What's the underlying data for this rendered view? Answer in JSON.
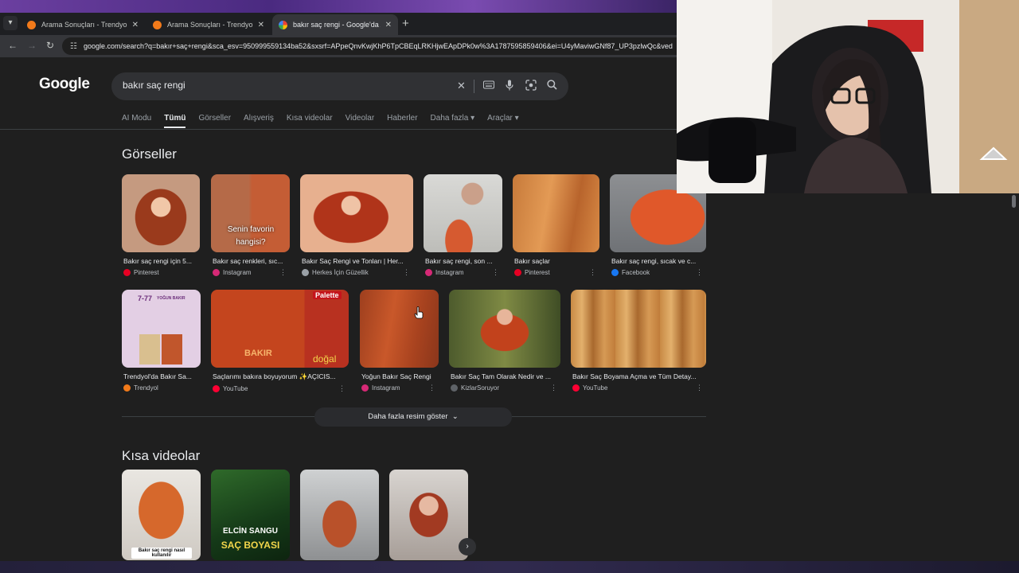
{
  "browser": {
    "tabs": [
      {
        "title": "Arama Sonuçları - Trendyol",
        "active": false
      },
      {
        "title": "Arama Sonuçları - Trendyol",
        "active": false
      },
      {
        "title": "bakır saç rengi - Google'da Ara",
        "active": true
      }
    ],
    "url": "google.com/search?q=bakır+saç+rengi&sca_esv=950999559134ba52&sxsrf=APpeQnvKwjKhP6TpCBEqLRKHjwEApDPk0w%3A1787595859406&ei=U4yMaviwGNf87_UP3pzlwQc&ved"
  },
  "google": {
    "logo": "Google",
    "query": "bakır saç rengi",
    "nav_tabs": [
      "AI Modu",
      "Tümü",
      "Görseller",
      "Alışveriş",
      "Kısa videolar",
      "Videolar",
      "Haberler",
      "Daha fazla",
      "Araçlar"
    ],
    "images_title": "Görseller",
    "images_row1": [
      {
        "caption": "Bakır saç rengi için 5...",
        "source": "Pinterest",
        "color": "#e60023"
      },
      {
        "caption": "Bakır saç renkleri, sıc...",
        "source": "Instagram",
        "color": "#d62976"
      },
      {
        "caption": "Bakır Saç Rengi ve Tonları | Her...",
        "source": "Herkes İçin Güzellik",
        "color": "#9aa0a6"
      },
      {
        "caption": "Bakır saç rengi, son ...",
        "source": "Instagram",
        "color": "#d62976"
      },
      {
        "caption": "Bakır saçlar",
        "source": "Pinterest",
        "color": "#e60023"
      },
      {
        "caption": "Bakır saç rengi, sıcak ve c...",
        "source": "Facebook",
        "color": "#1877f2"
      }
    ],
    "images_row2": [
      {
        "caption": "Trendyol'da Bakır Sa...",
        "source": "Trendyol",
        "color": "#f27a1a"
      },
      {
        "caption": "Saçlarımı bakıra boyuyorum ✨AÇICIS...",
        "source": "YouTube",
        "color": "#ff0033"
      },
      {
        "caption": "Yoğun Bakır Saç Rengi",
        "source": "Instagram",
        "color": "#d62976"
      },
      {
        "caption": "Bakır Saç Tam Olarak Nedir ve ...",
        "source": "KizlarSoruyor",
        "color": "#5f6368"
      },
      {
        "caption": "Bakır Saç Boyama Açma ve Tüm Detay...",
        "source": "YouTube",
        "color": "#ff0033"
      }
    ],
    "thumb_texts": {
      "favorite": "Senin favorin hangisi?",
      "trendyol_label": "7-77",
      "trendyol_sub": "YOĞUN BAKIR",
      "palette": "Palette",
      "dogal": "doğal",
      "bakir": "BAKIR",
      "vid1": "Bakır saç rengi nasıl kullanılır",
      "vid2a": "ELCİN SANGU",
      "vid2b": "SAÇ BOYASI"
    },
    "more_images": "Daha fazla resim göster",
    "short_videos_title": "Kısa videolar"
  },
  "icons": {
    "clear": "close-icon",
    "keyboard": "keyboard-icon",
    "mic": "mic-icon",
    "lens": "camera-lens-icon",
    "search": "search-icon"
  }
}
